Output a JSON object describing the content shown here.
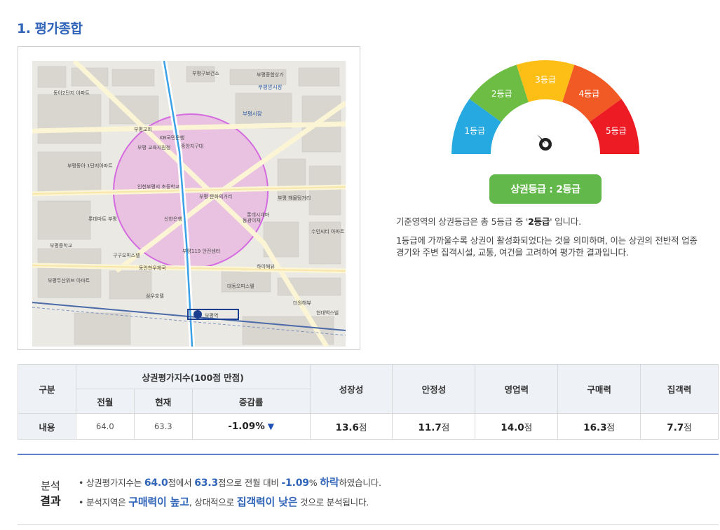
{
  "section": {
    "title": "1. 평가종합"
  },
  "map": {
    "labels": {
      "l1": "부평구보건소",
      "l2": "부평종합상가",
      "l3": "부평깡시장",
      "l4": "부평시장",
      "l5": "동아2단지 아파트",
      "l6": "부평교회",
      "l7": "KB국민은행",
      "l8": "중앙지구대",
      "l9": "부평 교육지원청",
      "l10": "부평동아 1단지아파트",
      "l11": "인천부평서 초등학교",
      "l12": "부평 문화의거리",
      "l13": "부평 해물탕거리",
      "l14": "신한은행",
      "l15": "롯데마트 부평",
      "l16": "롯데시네마",
      "l17": "부평중학교",
      "l18": "구구오피스텔",
      "l19": "부평119 안전센터",
      "l20": "동인천우체국",
      "l21": "부평두산위브 아파트",
      "l22": "대동오피스텔",
      "l23": "삼우호텔",
      "l24": "더원해뷰",
      "l25": "현대백스빌",
      "l26": "부평역",
      "l27": "동광이재",
      "l28": "수인씨티 아파트",
      "l29": "하이해뷰"
    }
  },
  "gauge": {
    "segments": [
      "1등급",
      "2등급",
      "3등급",
      "4등급",
      "5등급"
    ],
    "colors": [
      "#26a9e0",
      "#6dbd45",
      "#fdbe16",
      "#f15a24",
      "#ed1c24"
    ],
    "needle_grade": 2
  },
  "grade_badge": "상권등급 : 2등급",
  "description": {
    "line1_pre": "기준영역의 상권등급은 총 5등급 중 '",
    "line1_grade": "2등급",
    "line1_post": "' 입니다.",
    "line2": "1등급에 가까울수록 상권이 활성화되었다는 것을 의미하며, 이는 상권의 전반적 업종경기와 주변 집객시설, 교통, 여건을 고려하여 평가한 결과입니다."
  },
  "table": {
    "headers": {
      "category": "구분",
      "index_group": "상권평가지수(100점 만점)",
      "prev_month": "전월",
      "current": "현재",
      "change": "증감률",
      "growth": "성장성",
      "stability": "안정성",
      "business": "영업력",
      "purchasing": "구매력",
      "attraction": "집객력"
    },
    "row": {
      "label": "내용",
      "prev_month": "64.0",
      "current": "63.3",
      "change": "-1.09%",
      "change_arrow": "▼",
      "growth": "13.6",
      "stability": "11.7",
      "business": "14.0",
      "purchasing": "16.3",
      "attraction": "7.7",
      "unit": "점"
    }
  },
  "analysis": {
    "heading_line1": "분석",
    "heading_line2": "결과",
    "line1": {
      "t1": "• 상권평가지수는 ",
      "v1": "64.0",
      "t2": "점에서 ",
      "v2": "63.3",
      "t3": "점으로 전월 대비 ",
      "v3": "-1.09",
      "t4": "% ",
      "v4": "하락",
      "t5": "하였습니다."
    },
    "line2": {
      "t1": "• 분석지역은 ",
      "h1": "구매력이 높고",
      "t2": ", 상대적으로 ",
      "h2": "집객력이 낮은",
      "t3": " 것으로 분석됩니다."
    }
  }
}
